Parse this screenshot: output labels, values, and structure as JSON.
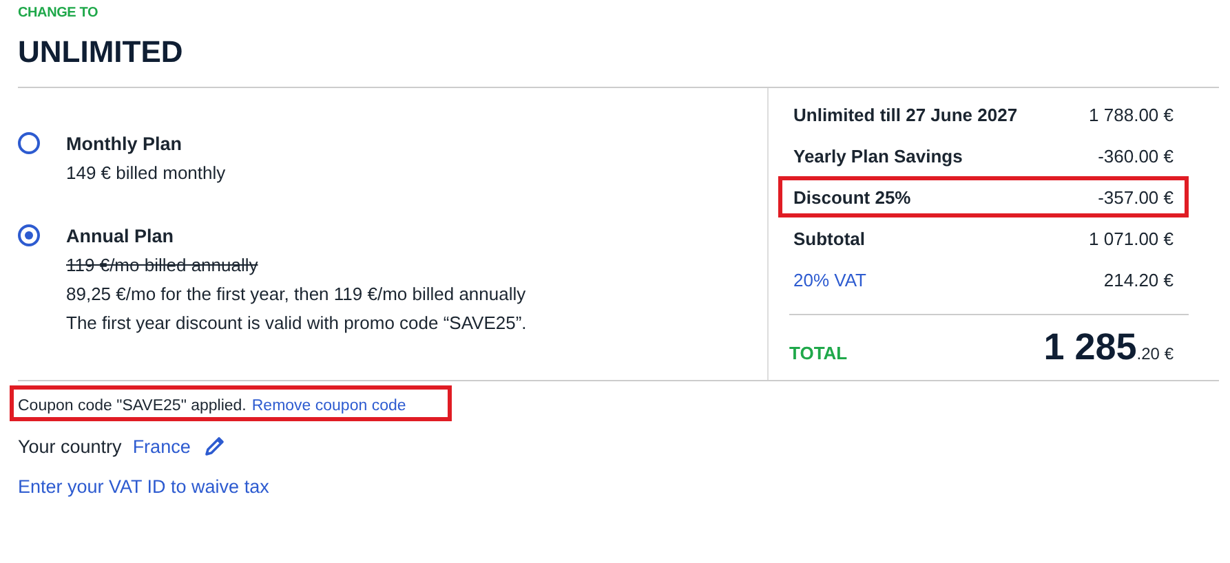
{
  "eyebrow": "CHANGE TO",
  "title": "UNLIMITED",
  "plans": [
    {
      "name": "Monthly Plan",
      "selected": false,
      "lines": [
        "149 € billed monthly"
      ]
    },
    {
      "name": "Annual Plan",
      "selected": true,
      "old_price": "119 €/mo billed annually",
      "lines": [
        "89,25 €/mo for the first year, then 119 €/mo billed annually",
        "The first year discount is valid with promo code “SAVE25”."
      ]
    }
  ],
  "summary": [
    {
      "kind": "item",
      "label": "Unlimited till 27 June 2027",
      "amount": "1 788.00 €",
      "highlighted": false
    },
    {
      "kind": "item",
      "label": "Yearly Plan Savings",
      "amount": "-360.00 €",
      "highlighted": false
    },
    {
      "kind": "item",
      "label": "Discount 25%",
      "amount": "-357.00 €",
      "highlighted": true
    },
    {
      "kind": "item",
      "label": "Subtotal",
      "amount": "1 071.00 €",
      "highlighted": false
    },
    {
      "kind": "link",
      "label": "20% VAT",
      "amount": "214.20 €",
      "highlighted": false
    }
  ],
  "total": {
    "label": "TOTAL",
    "amount_main": "1 285",
    "amount_cents": ".20 €"
  },
  "coupon": {
    "text": "Coupon code \"SAVE25\" applied.",
    "link": "Remove coupon code",
    "highlighted": true
  },
  "country": {
    "label": "Your country",
    "value": "France"
  },
  "vat_link": "Enter your VAT ID to waive tax"
}
